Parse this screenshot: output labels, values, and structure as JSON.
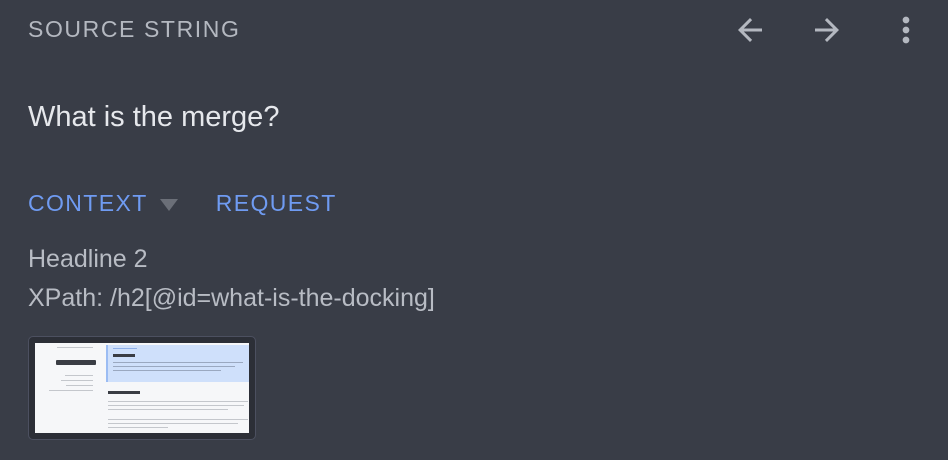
{
  "header": {
    "title": "SOURCE STRING",
    "icons": [
      "arrow-back-icon",
      "arrow-forward-icon",
      "more-vert-icon"
    ]
  },
  "source": {
    "text": "What is the merge?"
  },
  "tabs": [
    {
      "label": "CONTEXT"
    },
    {
      "label": "REQUEST"
    }
  ],
  "context": {
    "type": "Headline 2",
    "xpath": "XPath: /h2[@id=what-is-the-docking]"
  },
  "screenshot": {
    "heading": "The merge"
  },
  "colors": {
    "background": "#393d47",
    "accent": "#6f9bf2",
    "primary_text": "#e6e8ec",
    "secondary_text": "#b4b8c0"
  }
}
